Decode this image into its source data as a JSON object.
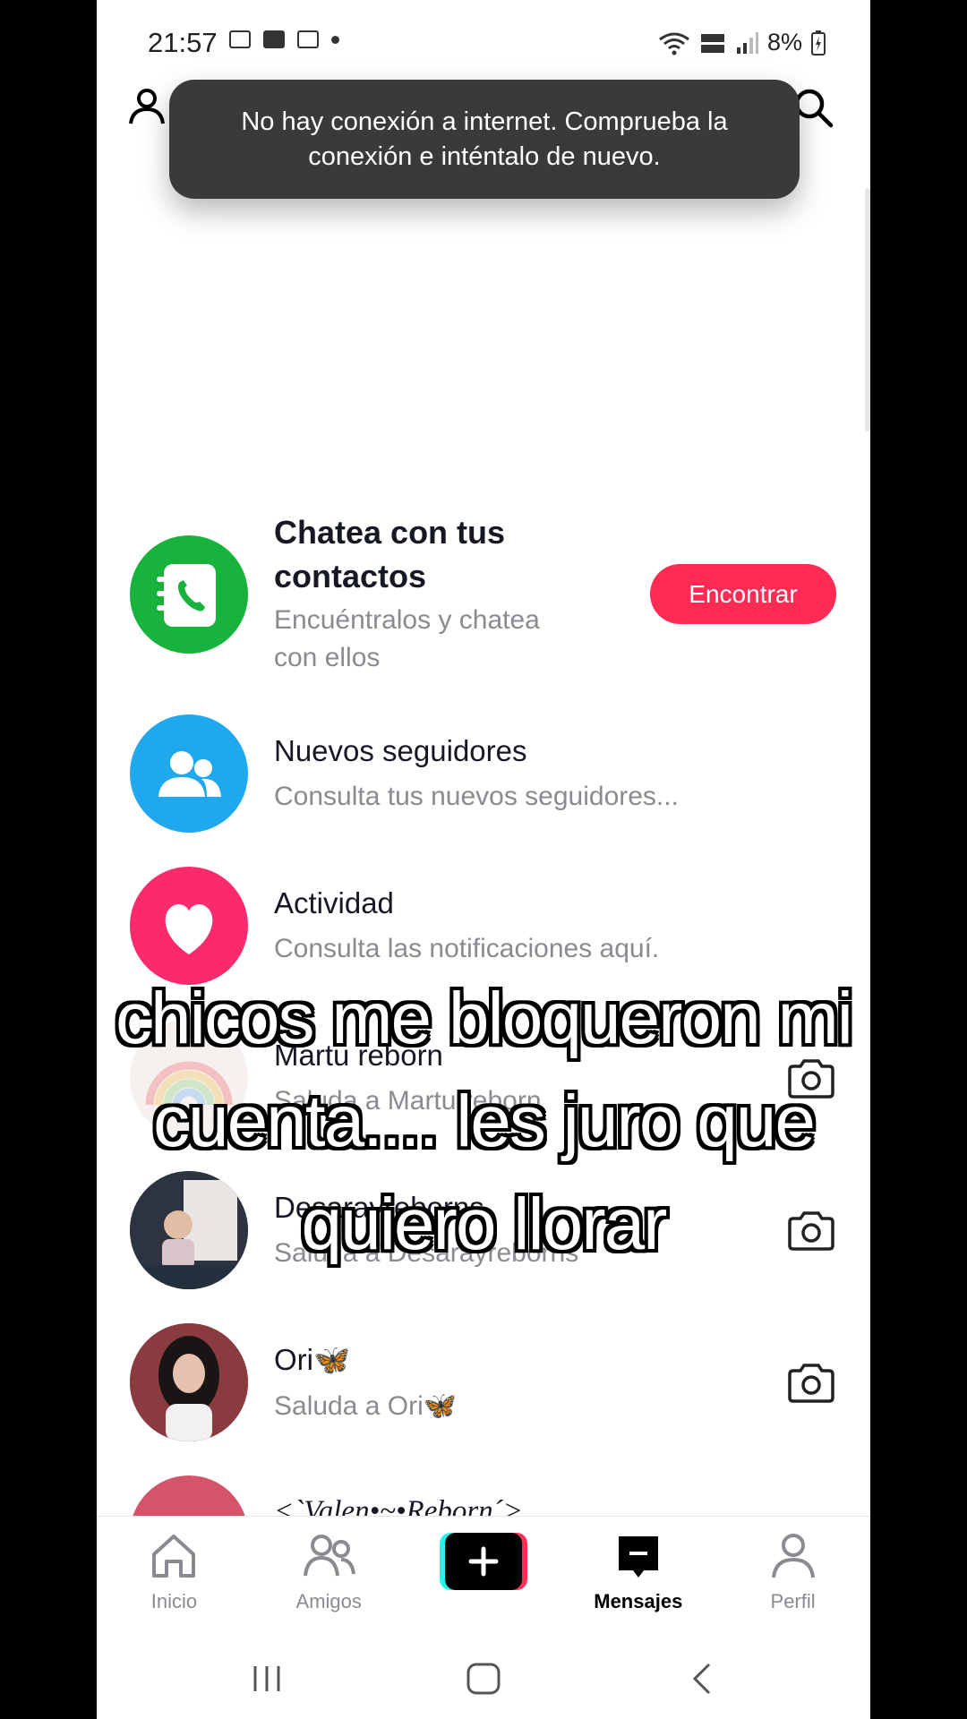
{
  "status_bar": {
    "time": "21:57",
    "battery": "8%"
  },
  "toast": {
    "message": "No hay conexión a internet. Comprueba la conexión e inténtalo de nuevo."
  },
  "contacts_card": {
    "title": "Chatea con tus contactos",
    "subtitle": "Encuéntralos y chatea con ellos",
    "button": "Encontrar",
    "icon": "contacts-phone-icon",
    "color": "#18b33c"
  },
  "followers_row": {
    "title": "Nuevos seguidores",
    "subtitle": "Consulta tus nuevos seguidores...",
    "icon": "people-icon",
    "color": "#1fa8ee"
  },
  "activity_row": {
    "title": "Actividad",
    "subtitle": "Consulta las notificaciones aquí.",
    "icon": "heart-icon",
    "color": "#fa2a6c"
  },
  "suggested": [
    {
      "name": "Martu reborn",
      "subtitle": "Saluda a Martu reborn"
    },
    {
      "name": "Desarayreborns",
      "subtitle": "Saluda a Desarayreborns"
    },
    {
      "name": "Ori🦋",
      "subtitle": "Saluda a Ori🦋"
    },
    {
      "name": "<`Valen•~•Reborn´>",
      "subtitle": ""
    }
  ],
  "caption": {
    "line1": "chicos me bloqueron mi",
    "line2": "cuenta.... les juro que",
    "line3": "quiero llorar"
  },
  "nav": {
    "home": "Inicio",
    "friends": "Amigos",
    "messages": "Mensajes",
    "profile": "Perfil"
  },
  "colors": {
    "accent": "#fe2c55",
    "create_cyan": "#25f4ee",
    "create_red": "#fe2c55"
  }
}
